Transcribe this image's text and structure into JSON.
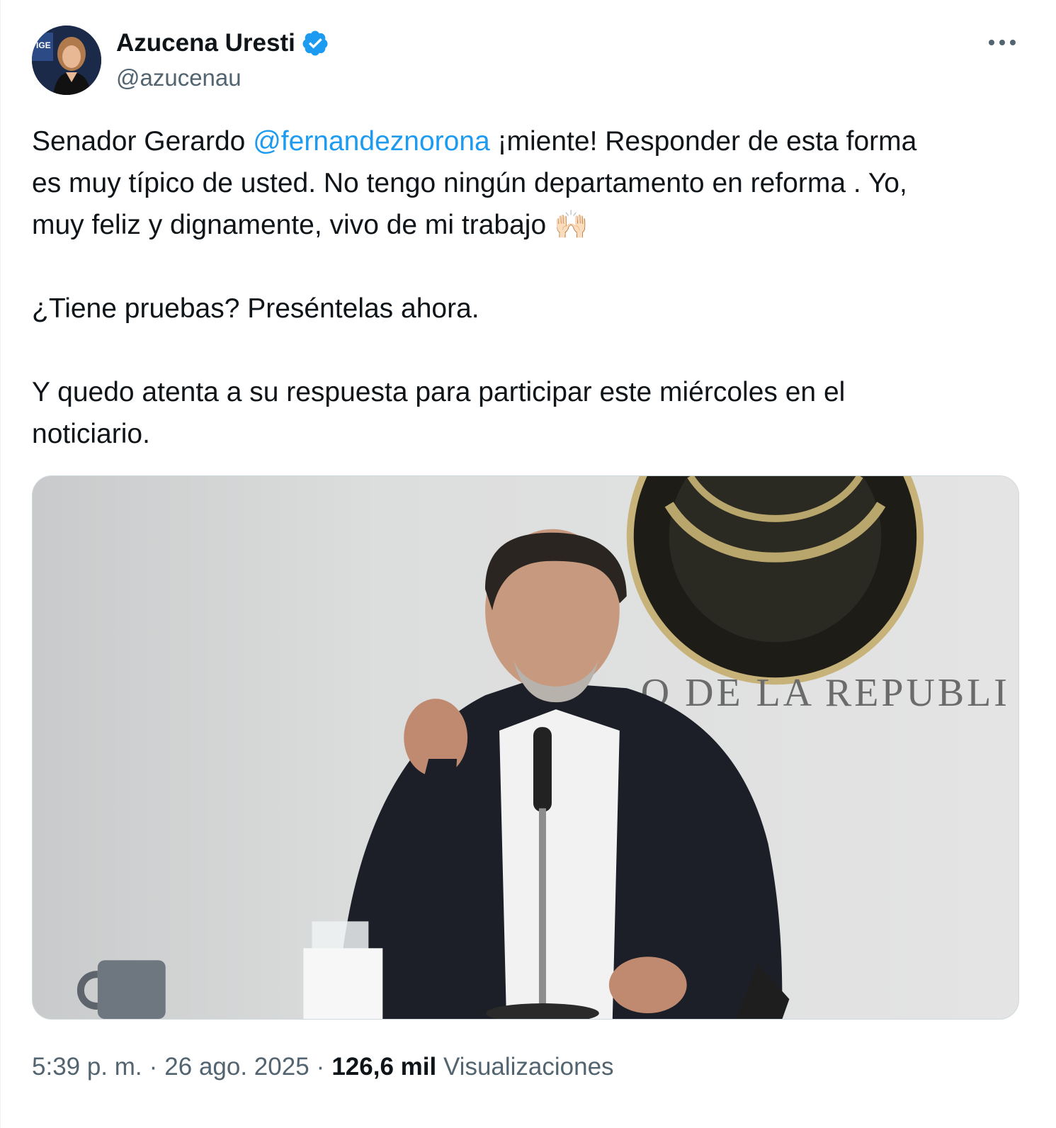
{
  "author": {
    "display_name": "Azucena Uresti",
    "handle": "@azucenau",
    "verified": true,
    "avatar_icon": "profile-photo"
  },
  "tweet": {
    "line1_pre": "Senador Gerardo ",
    "mention": "@fernandeznorona",
    "line1_post": " ¡miente! Responder de esta forma",
    "line2": "es muy típico de usted. No tengo ningún departamento en reforma . Yo,",
    "line3": "muy feliz y dignamente, vivo de mi trabajo ",
    "emoji": "🙌🏻",
    "paragraph2": "¿Tiene pruebas? Preséntelas ahora.",
    "paragraph3_line1": "Y quedo atenta a su respuesta para participar este miércoles en el",
    "paragraph3_line2": "noticiario."
  },
  "media": {
    "sign_text": "O DE LA REPUBLI"
  },
  "meta": {
    "time": "5:39 p. m.",
    "separator": "·",
    "date": "26 ago. 2025",
    "views_count": "126,6 mil",
    "views_label": "Visualizaciones"
  },
  "colors": {
    "link": "#1d9bf0",
    "secondary": "#536471",
    "verified": "#1d9bf0",
    "text": "#0f1419"
  },
  "icons": {
    "more": "more-dots-icon",
    "verified": "verified-badge-icon"
  }
}
